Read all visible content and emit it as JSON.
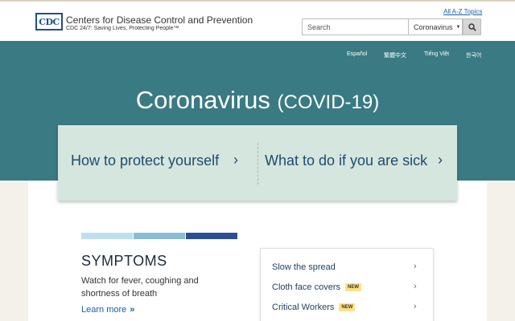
{
  "header": {
    "logo_text": "CDC",
    "org_name": "Centers for Disease Control and Prevention",
    "tagline": "CDC 24/7: Saving Lives, Protecting People™",
    "az_link": "All A-Z Topics",
    "search_placeholder": "Search",
    "search_scope": "Coronavirus"
  },
  "languages": [
    "Español",
    "繁體中文",
    "Tiếng Việt",
    "한국어"
  ],
  "hero": {
    "title": "Coronavirus",
    "subtitle": "(COVID-19)"
  },
  "panel": {
    "left_link": "How to protect yourself",
    "right_link": "What to do if you are sick"
  },
  "symptoms": {
    "title": "SYMPTOMS",
    "description": "Watch for fever, coughing and shortness of breath",
    "learn_more": "Learn more"
  },
  "card": {
    "items": [
      {
        "label": "Slow the spread",
        "badge": ""
      },
      {
        "label": "Cloth face covers",
        "badge": "NEW"
      },
      {
        "label": "Critical Workers",
        "badge": "NEW"
      }
    ]
  },
  "colors": {
    "hero": "#3a7a82",
    "panel": "#d5e6df",
    "bar_light": "#bde0ee",
    "bar_mid": "#8bbcd6",
    "bar_dark": "#2c4e94",
    "badge": "#ffe082"
  }
}
